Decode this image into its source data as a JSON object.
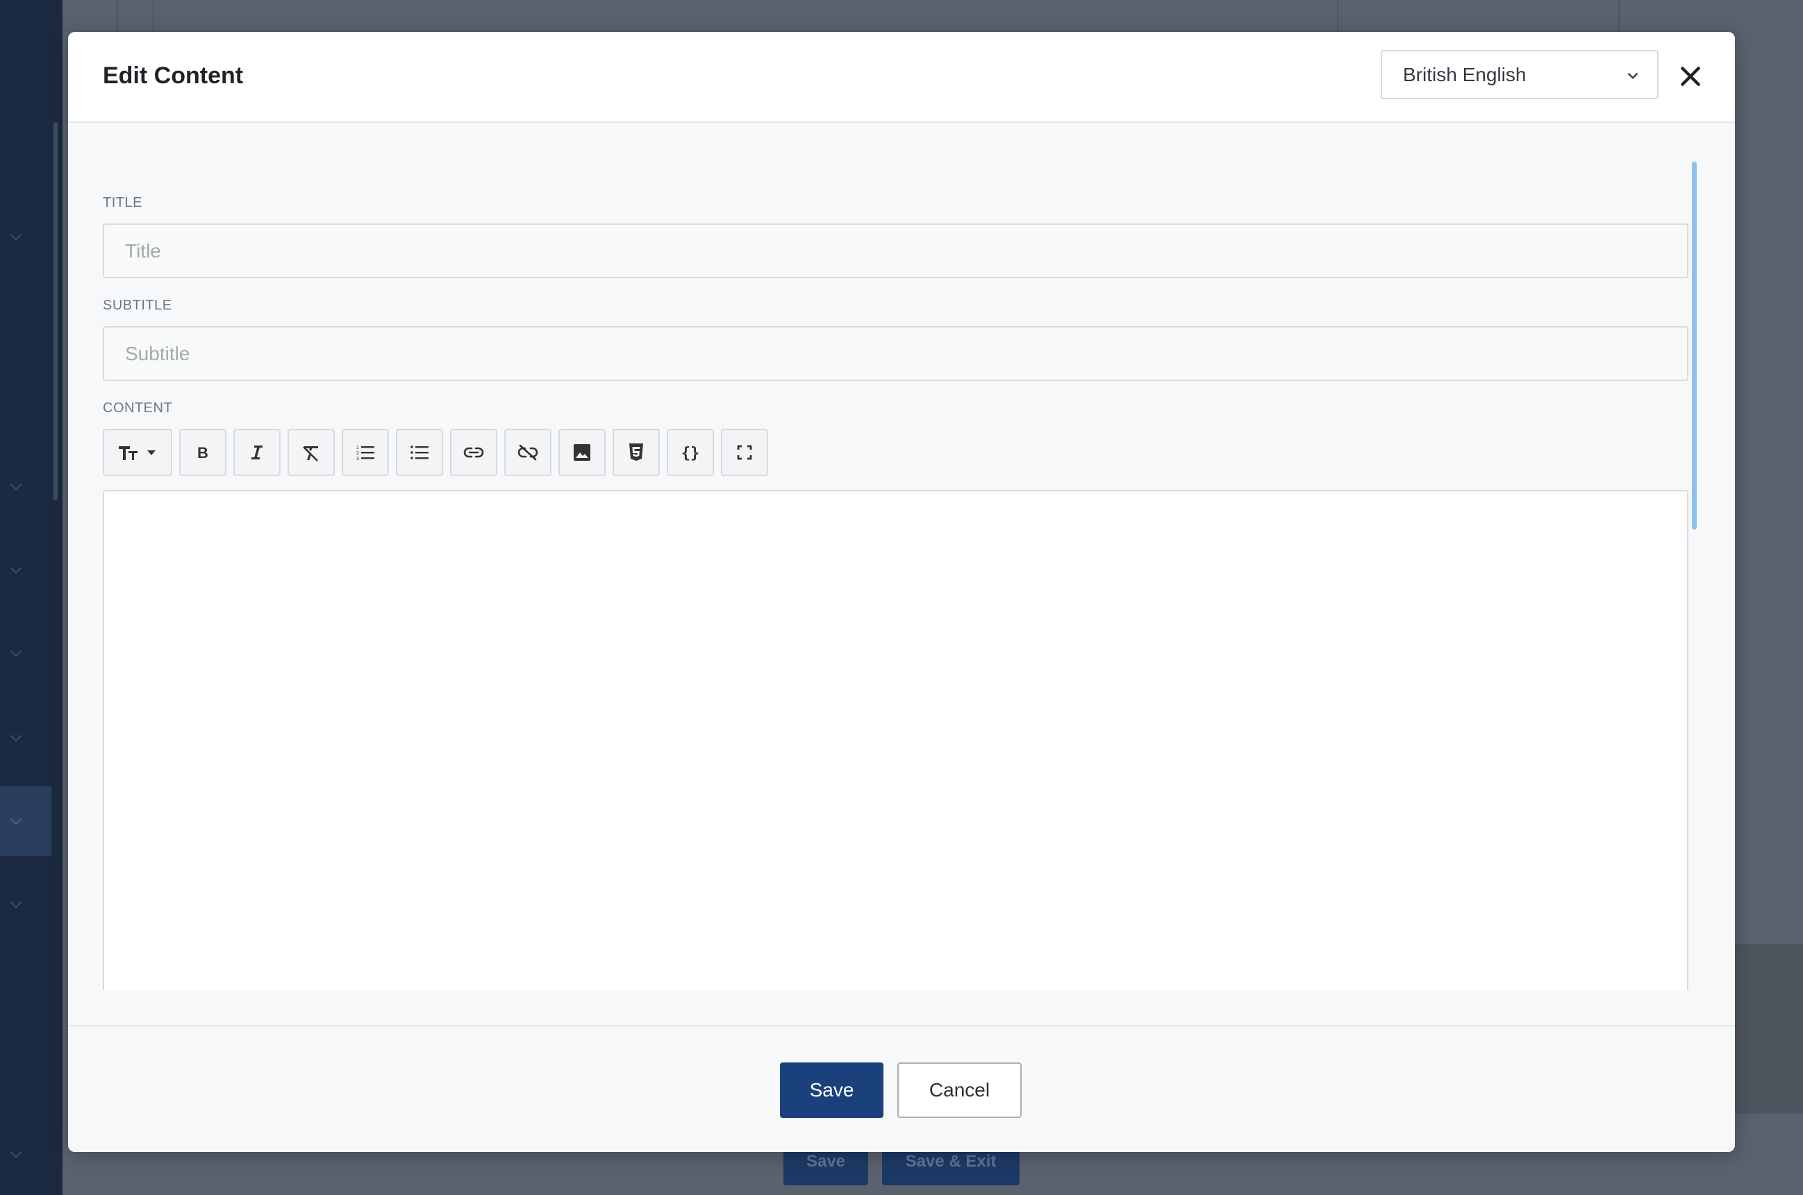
{
  "background": {
    "footer_save_label": "Save",
    "footer_save_exit_label": "Save & Exit"
  },
  "modal": {
    "title": "Edit Content",
    "language_selected": "British English",
    "close_icon": "close-icon",
    "fields": {
      "title_label": "TITLE",
      "title_placeholder": "Title",
      "subtitle_label": "SUBTITLE",
      "subtitle_placeholder": "Subtitle",
      "content_label": "CONTENT"
    },
    "toolbar": [
      {
        "icon": "text-size-icon",
        "dropdown": true
      },
      {
        "icon": "bold-icon"
      },
      {
        "icon": "italic-icon"
      },
      {
        "icon": "clear-format-icon"
      },
      {
        "icon": "ordered-list-icon"
      },
      {
        "icon": "unordered-list-icon"
      },
      {
        "icon": "link-icon"
      },
      {
        "icon": "unlink-icon"
      },
      {
        "icon": "image-icon"
      },
      {
        "icon": "html5-icon"
      },
      {
        "icon": "code-braces-icon"
      },
      {
        "icon": "fullscreen-icon"
      }
    ],
    "footer": {
      "save_label": "Save",
      "cancel_label": "Cancel"
    }
  },
  "colors": {
    "primary": "#1b417d",
    "sidebar": "#1b2a40",
    "overlay": "#5a626d",
    "scrollbar": "#8fc1ee"
  }
}
